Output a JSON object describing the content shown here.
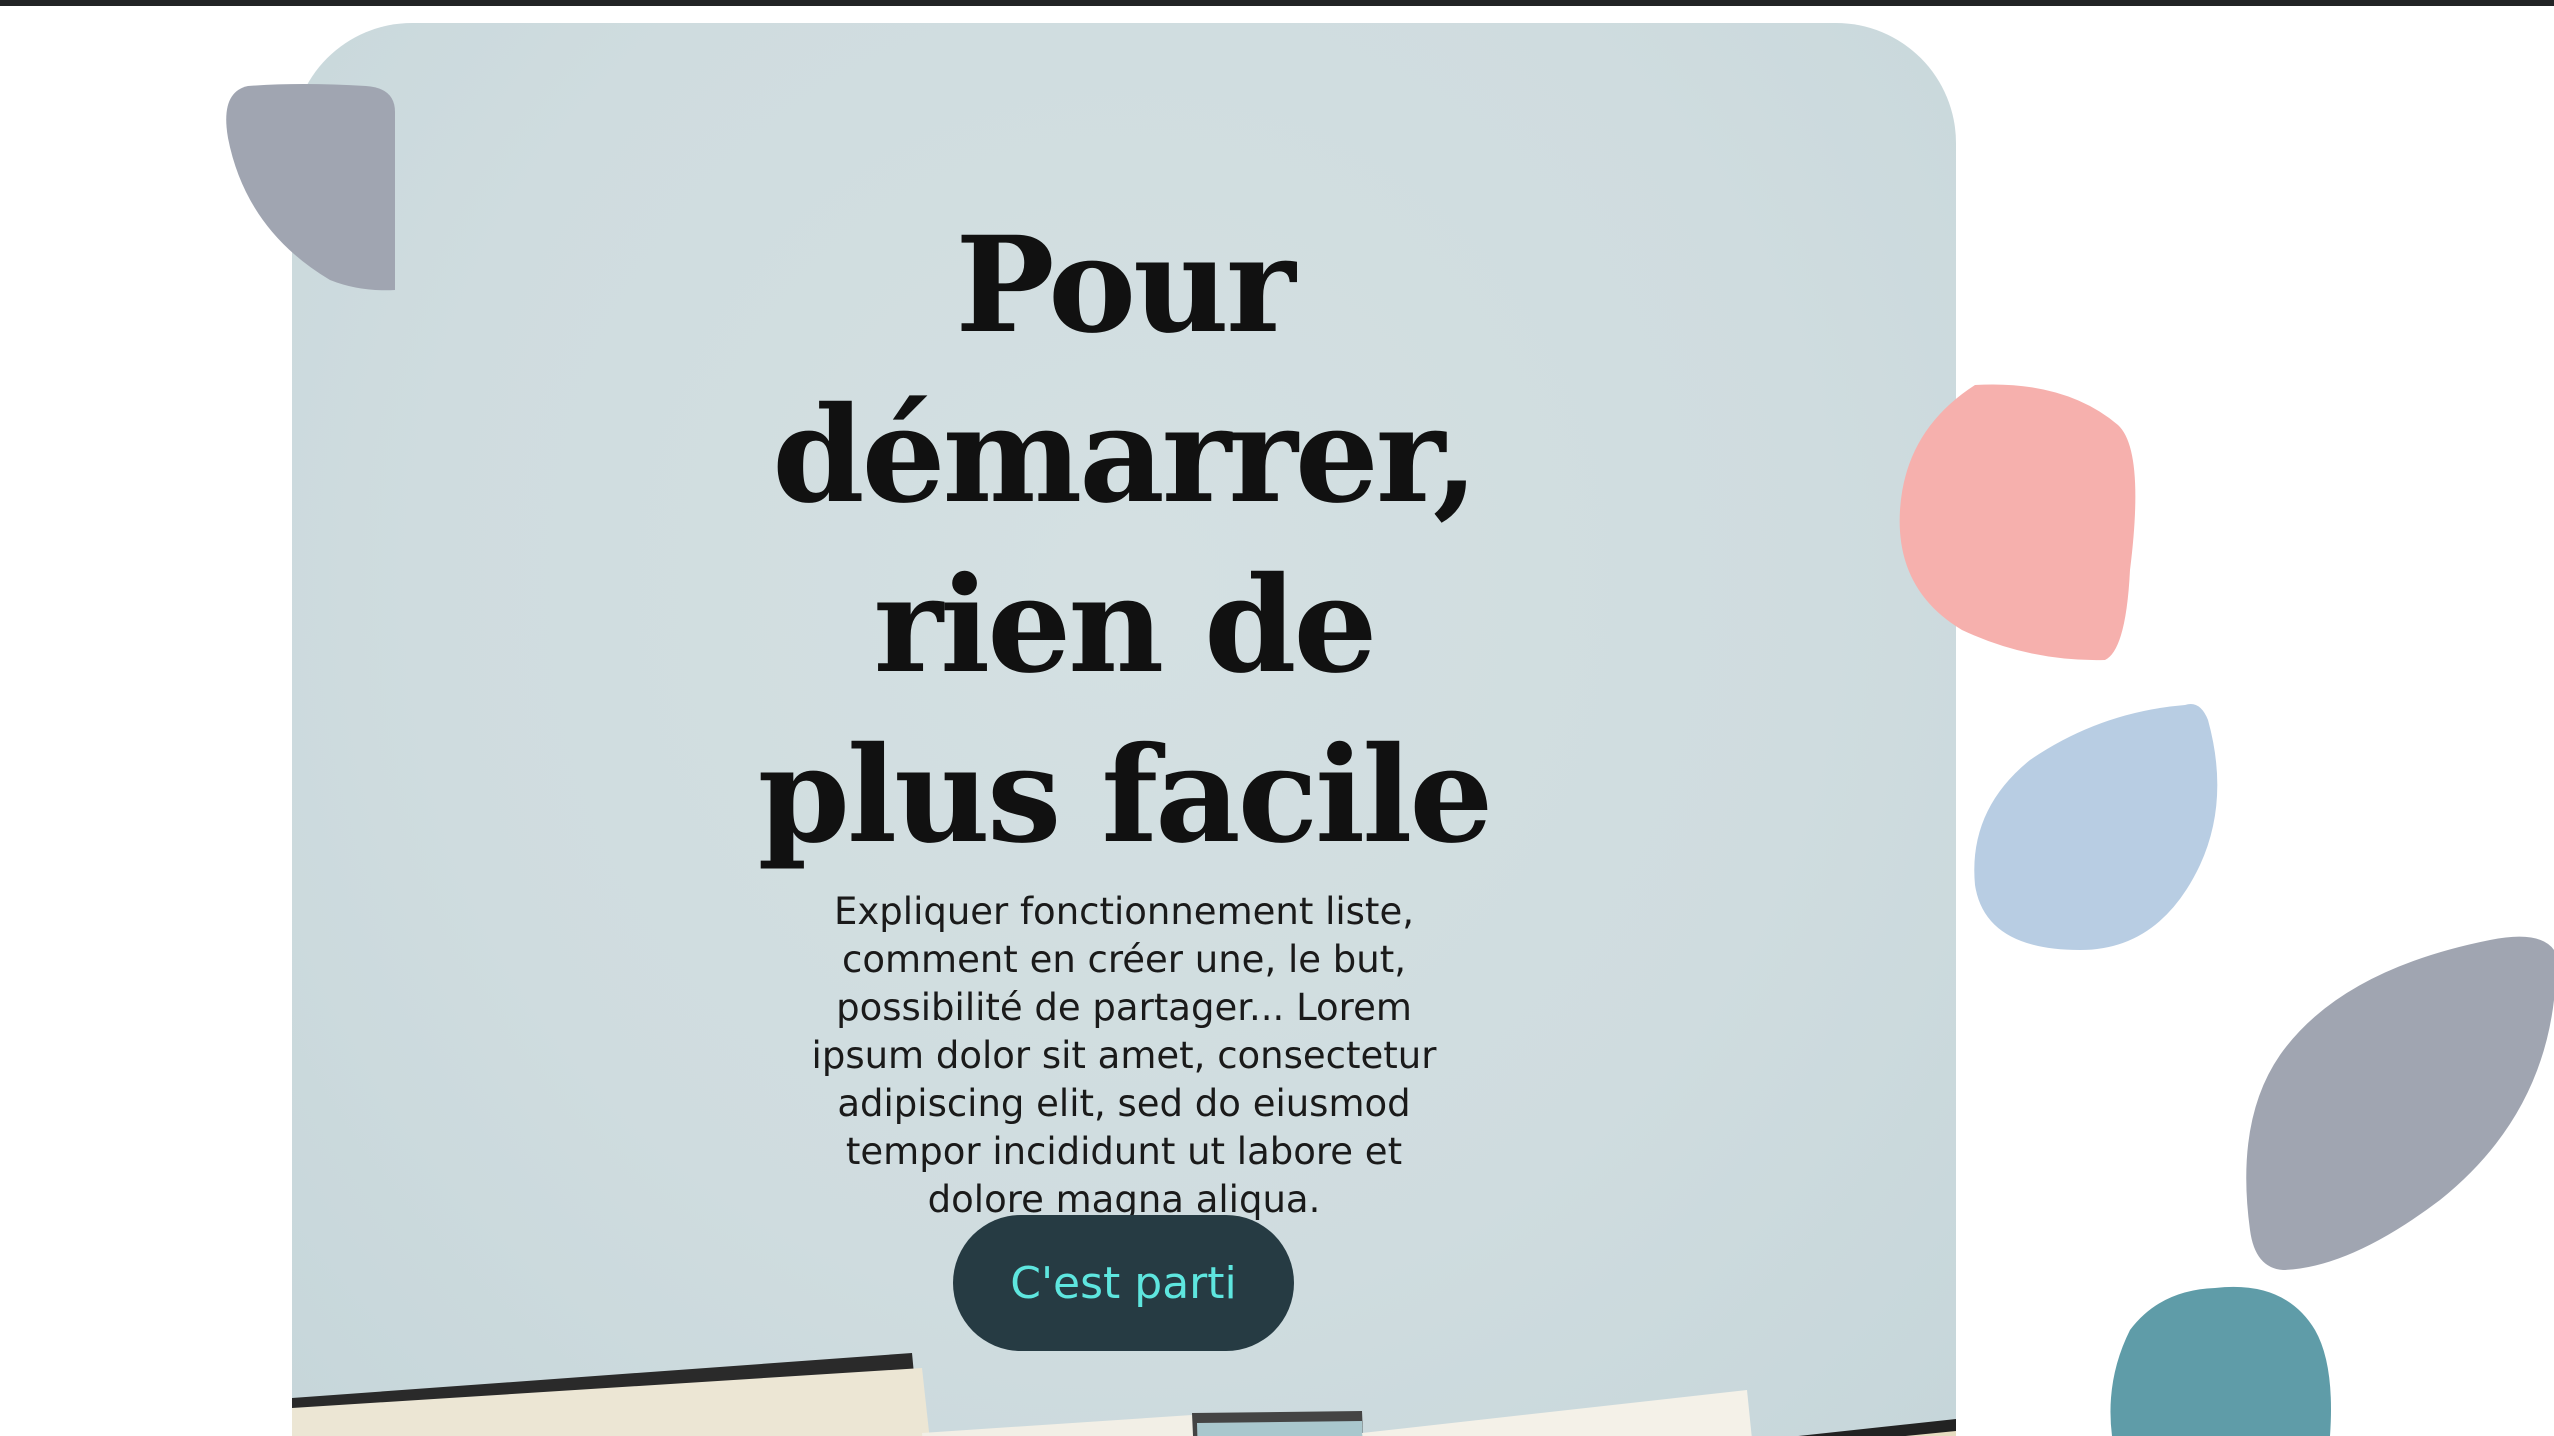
{
  "hero": {
    "title_lines": [
      "Pour",
      "démarrer,",
      "rien de",
      "plus facile"
    ],
    "description": "Expliquer fonctionnement liste, comment en créer une, le but, possibilité de partager... Lorem ipsum dolor sit amet, consectetur adipiscing elit, sed do eiusmod tempor incididunt ut labore et dolore magna aliqua.",
    "cta_label": "C'est parti"
  },
  "colors": {
    "card_background": "#d4e0e2",
    "button_background": "#263b43",
    "button_text": "#5ee6df",
    "petal_gray": "#a0a5b1",
    "petal_pink": "#f6b0ad",
    "petal_blue": "#b8cde3",
    "petal_teal": "#5f9ca8"
  },
  "decorations": [
    "gray-petal",
    "pink-petal",
    "blue-petal",
    "gray-petal",
    "teal-petal",
    "books-photo"
  ]
}
